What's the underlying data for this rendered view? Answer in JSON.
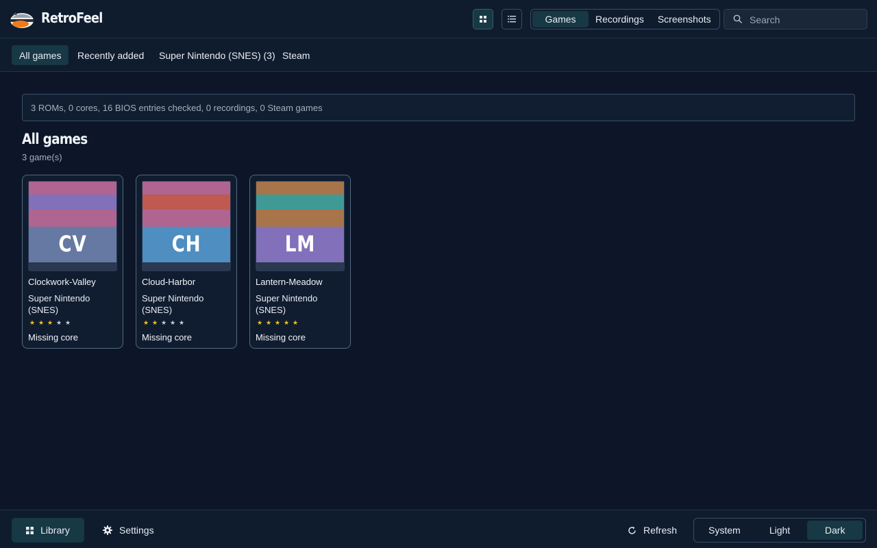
{
  "app": {
    "title": "RetroFeel"
  },
  "header": {
    "view_modes": [
      {
        "icon": "grid-icon",
        "active": true
      },
      {
        "icon": "list-icon",
        "active": false
      }
    ],
    "sections": [
      {
        "label": "Games",
        "active": true
      },
      {
        "label": "Recordings",
        "active": false
      },
      {
        "label": "Screenshots",
        "active": false
      }
    ],
    "search": {
      "placeholder": "Search",
      "value": ""
    }
  },
  "filters": [
    {
      "label": "All games",
      "active": true
    },
    {
      "label": "Recently added",
      "active": false
    },
    {
      "label": "Super Nintendo (SNES) (3)",
      "active": false
    },
    {
      "label": "Steam",
      "active": false
    }
  ],
  "status_text": "3 ROMs, 0 cores, 16 BIOS entries checked, 0 recordings, 0 Steam games",
  "main": {
    "title": "All games",
    "count": "3 game(s)"
  },
  "games": [
    {
      "name": "Clockwork-Valley",
      "initials": "CV",
      "platform": "Super Nintendo (SNES)",
      "rating": 3,
      "status": "Missing core",
      "cover_colors": [
        "#b06490",
        "#8270ba",
        "#b06490",
        "#6579a3"
      ]
    },
    {
      "name": "Cloud-Harbor",
      "initials": "CH",
      "platform": "Super Nintendo (SNES)",
      "rating": 2,
      "status": "Missing core",
      "cover_colors": [
        "#b06490",
        "#c0594f",
        "#b06490",
        "#4e8ec1"
      ]
    },
    {
      "name": "Lantern-Meadow",
      "initials": "LM",
      "platform": "Super Nintendo (SNES)",
      "rating": 5,
      "status": "Missing core",
      "cover_colors": [
        "#a8744a",
        "#3f9a96",
        "#a8744a",
        "#8270ba"
      ]
    }
  ],
  "footer": {
    "nav": [
      {
        "label": "Library",
        "icon": "grid-icon",
        "active": true
      },
      {
        "label": "Settings",
        "icon": "gear-icon",
        "active": false
      }
    ],
    "refresh_label": "Refresh",
    "themes": [
      {
        "label": "System",
        "active": false
      },
      {
        "label": "Light",
        "active": false
      },
      {
        "label": "Dark",
        "active": true
      }
    ]
  },
  "colors": {
    "background": "#0c1628",
    "panel": "#0f1c2e",
    "accent_active": "#173845",
    "star_filled": "#f5c518",
    "star_empty": "#c8d0da"
  }
}
